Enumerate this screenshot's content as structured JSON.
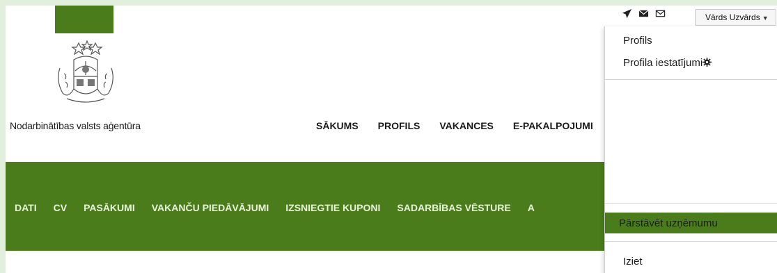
{
  "header": {
    "agency_name": "Nodarbinātības valsts aģentūra",
    "top_nav": [
      "SĀKUMS",
      "PROFILS",
      "VAKANCES",
      "E-PAKALPOJUMI"
    ]
  },
  "user_menu": {
    "user_name": "Vārds Uzvārds",
    "items": {
      "profile": "Profils",
      "profile_settings": "Profila iestatījumi",
      "represent_company": "Pārstāvēt uzņēmumu",
      "logout": "Iziet"
    }
  },
  "sub_nav": [
    "DATI",
    "CV",
    "PASĀKUMI",
    "VAKANČU PIEDĀVĀJUMI",
    "IZSNIEGTIE KUPONI",
    "SADARBĪBAS VĒSTURE",
    "A"
  ],
  "icons": {
    "send": "paper-plane-icon",
    "mail_filled": "envelope-filled-icon",
    "mail_outline": "envelope-outline-icon",
    "settings": "gear-icon",
    "user_caret": "caret-down-icon",
    "coat_of_arms": "coat-of-arms-icon"
  },
  "colors": {
    "brand_green": "#4a7c1c",
    "page_border": "#e2efdc",
    "subnav_text": "#e8f2d8"
  }
}
